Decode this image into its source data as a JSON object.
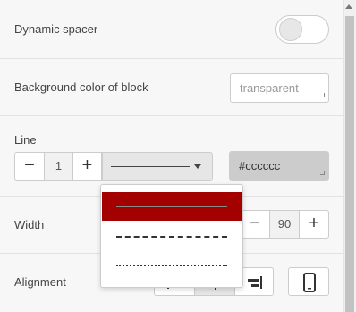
{
  "settings": {
    "dynamic_spacer": {
      "label": "Dynamic spacer",
      "enabled": false
    },
    "background": {
      "label": "Background color of block",
      "value": "transparent"
    },
    "line": {
      "label": "Line",
      "thickness": "1",
      "minus": "−",
      "plus": "+",
      "color": "#cccccc",
      "styles": [
        "solid",
        "dashed",
        "dotted"
      ],
      "selected_style": "solid"
    },
    "width": {
      "label": "Width",
      "value": "90",
      "minus": "−",
      "plus": "+"
    },
    "alignment": {
      "label": "Alignment"
    }
  },
  "colors": {
    "accent": "#a30000",
    "line_color_fill": "#cccccc"
  }
}
